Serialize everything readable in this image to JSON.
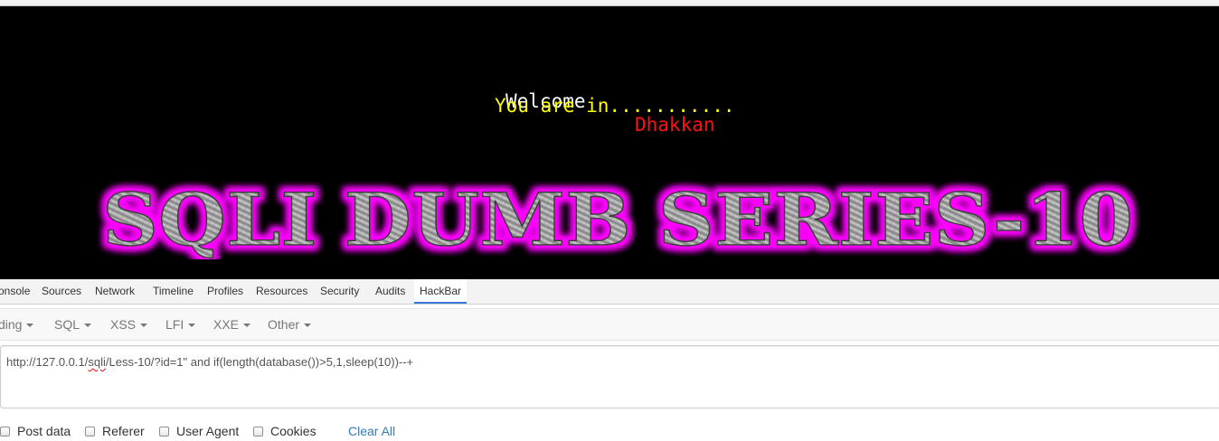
{
  "page": {
    "welcome": "Welcome",
    "username": "Dhakkan",
    "status": "You are in...........",
    "banner": "SQLI DUMB SERIES-10"
  },
  "devtools": {
    "tabs": [
      {
        "label": "onsole"
      },
      {
        "label": "Sources"
      },
      {
        "label": "Network"
      },
      {
        "label": "Timeline"
      },
      {
        "label": "Profiles"
      },
      {
        "label": "Resources"
      },
      {
        "label": "Security"
      },
      {
        "label": "Audits"
      },
      {
        "label": "HackBar"
      }
    ],
    "active_tab": "HackBar"
  },
  "hackbar": {
    "menus": [
      {
        "label": "ding"
      },
      {
        "label": "SQL"
      },
      {
        "label": "XSS"
      },
      {
        "label": "LFI"
      },
      {
        "label": "XXE"
      },
      {
        "label": "Other"
      }
    ],
    "url": {
      "prefix": "http://127.0.0.1/",
      "misspelled": "sqli",
      "suffix": "/Less-10/?id=1\" and if(length(database())>5,1,sleep(10))--+"
    },
    "options": [
      {
        "label": "Post data",
        "checked": false
      },
      {
        "label": "Referer",
        "checked": false
      },
      {
        "label": "User Agent",
        "checked": false
      },
      {
        "label": "Cookies",
        "checked": false
      }
    ],
    "clear_all": "Clear All"
  },
  "colors": {
    "page_background": "#000000",
    "username": "#ff1111",
    "status": "#ffff00",
    "banner_glow": "#ff00ff",
    "active_tab_underline": "#3879d9",
    "link": "#337ab7"
  }
}
